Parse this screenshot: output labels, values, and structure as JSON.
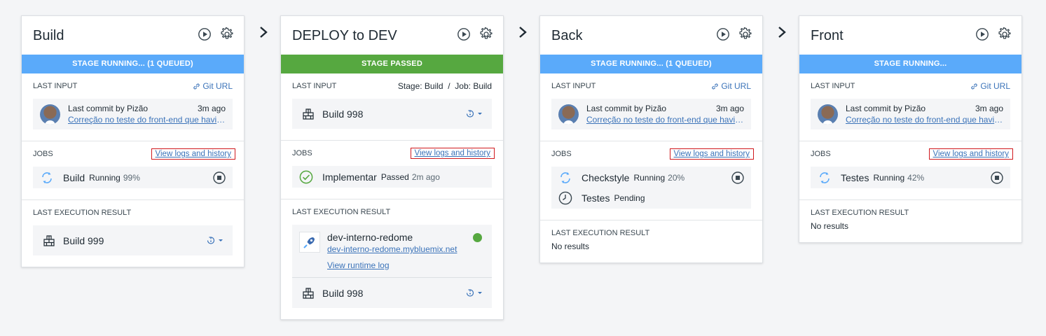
{
  "colors": {
    "running": "#5aaafa",
    "passed": "#56a840",
    "link": "#3b73b9",
    "highlight": "#d0191e"
  },
  "stages": [
    {
      "title": "Build",
      "banner": "STAGE RUNNING... (1 QUEUED)",
      "input_label": "LAST INPUT",
      "git_url": "Git URL",
      "commit_author": "Last commit by Pizão",
      "commit_time": "3m ago",
      "commit_message": "Correção no teste do front-end que havia …",
      "jobs_label": "JOBS",
      "view_logs": "View logs and history",
      "jobs": [
        {
          "name": "Build",
          "status": "Running",
          "pct": "99%",
          "icon": "running-icon"
        }
      ],
      "result_label": "LAST EXECUTION RESULT",
      "result_build": "Build 999"
    },
    {
      "title": "DEPLOY to DEV",
      "banner": "STAGE PASSED",
      "input_label": "LAST INPUT",
      "input_stage": "Stage: Build",
      "input_sep": "/",
      "input_job": "Job: Build",
      "input_build": "Build 998",
      "jobs_label": "JOBS",
      "view_logs": "View logs and history",
      "jobs": [
        {
          "name": "Implementar",
          "status": "Passed",
          "pct": "2m ago",
          "icon": "passed-icon"
        }
      ],
      "result_label": "LAST EXECUTION RESULT",
      "app_name": "dev-interno-redome",
      "app_url": "dev-interno-redome.mybluemix.net",
      "app_log": "View runtime log",
      "result_build": "Build 998"
    },
    {
      "title": "Back",
      "banner": "STAGE RUNNING... (1 QUEUED)",
      "input_label": "LAST INPUT",
      "git_url": "Git URL",
      "commit_author": "Last commit by Pizão",
      "commit_time": "3m ago",
      "commit_message": "Correção no teste do front-end que havia …",
      "jobs_label": "JOBS",
      "view_logs": "View logs and history",
      "jobs": [
        {
          "name": "Checkstyle",
          "status": "Running",
          "pct": "20%",
          "icon": "running-icon"
        },
        {
          "name": "Testes",
          "status": "Pending",
          "pct": "",
          "icon": "pending-icon"
        }
      ],
      "result_label": "LAST EXECUTION RESULT",
      "no_results": "No results"
    },
    {
      "title": "Front",
      "banner": "STAGE RUNNING...",
      "input_label": "LAST INPUT",
      "git_url": "Git URL",
      "commit_author": "Last commit by Pizão",
      "commit_time": "3m ago",
      "commit_message": "Correção no teste do front-end que havia …",
      "jobs_label": "JOBS",
      "view_logs": "View logs and history",
      "jobs": [
        {
          "name": "Testes",
          "status": "Running",
          "pct": "42%",
          "icon": "running-icon"
        }
      ],
      "result_label": "LAST EXECUTION RESULT",
      "no_results": "No results"
    }
  ]
}
